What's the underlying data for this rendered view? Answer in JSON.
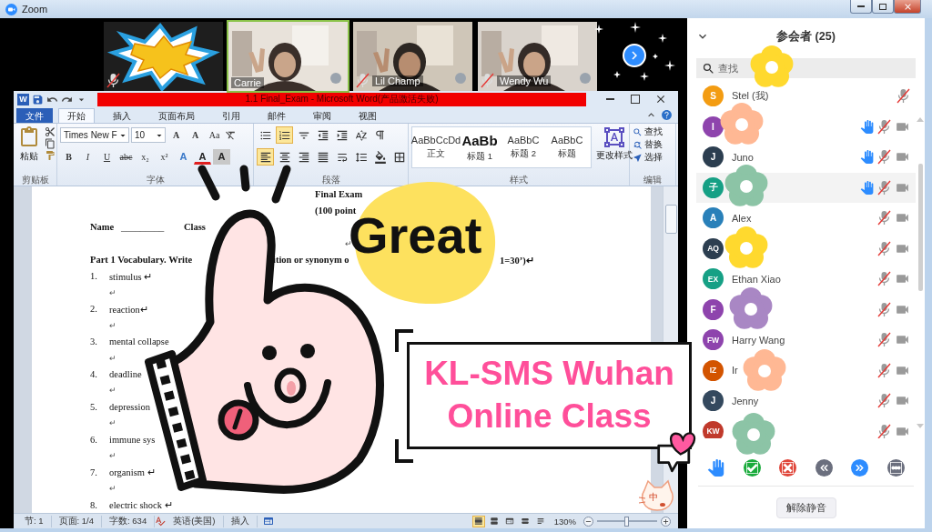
{
  "zoom_window": {
    "title": "Zoom"
  },
  "video_tiles": [
    {
      "kind": "sticker",
      "speaking": false,
      "muted": true
    },
    {
      "kind": "camera",
      "name": "Carrie",
      "speaking": true,
      "muted": false
    },
    {
      "kind": "camera",
      "name": "Lil Champ",
      "speaking": false,
      "muted": true
    },
    {
      "kind": "camera",
      "name": "Wendy Wu",
      "speaking": false,
      "muted": true
    }
  ],
  "word": {
    "logo": "W",
    "title": "1.1 Final_Exam - Microsoft Word(产品激活失败)",
    "tabs": [
      {
        "label": "文件",
        "kind": "file",
        "selected": false
      },
      {
        "label": "开始",
        "kind": "tab",
        "selected": true
      },
      {
        "label": "插入",
        "kind": "tab",
        "selected": false
      },
      {
        "label": "页面布局",
        "kind": "tab",
        "selected": false
      },
      {
        "label": "引用",
        "kind": "tab",
        "selected": false
      },
      {
        "label": "邮件",
        "kind": "tab",
        "selected": false
      },
      {
        "label": "审阅",
        "kind": "tab",
        "selected": false
      },
      {
        "label": "视图",
        "kind": "tab",
        "selected": false
      }
    ],
    "ribbon": {
      "groups": [
        "剪贴板",
        "字体",
        "段落",
        "样式",
        "编辑"
      ],
      "paste": "粘贴",
      "font_name": "Times New F",
      "font_size": "10",
      "size_buttons": [
        "A",
        "A"
      ],
      "case_button": "Aa",
      "format_buttons": [
        "B",
        "I",
        "U",
        "abc",
        "x₂",
        "x²"
      ],
      "color_buttons": [
        "A",
        "A",
        "A"
      ],
      "list_buttons": [
        {
          "selected": false
        },
        {
          "selected": true
        },
        {
          "selected": false
        }
      ],
      "align_buttons": [
        {
          "selected": true
        },
        {
          "selected": false
        },
        {
          "selected": false
        },
        {
          "selected": false
        },
        {
          "selected": false
        }
      ],
      "styles": [
        {
          "sample": "AaBbCcDd",
          "name": "正文"
        },
        {
          "sample": "AaBb",
          "name": "标题 1"
        },
        {
          "sample": "AaBbC",
          "name": "标题 2"
        },
        {
          "sample": "AaBbC",
          "name": "标题"
        }
      ],
      "change_styles": "更改样式",
      "editing": [
        "查找",
        "替换",
        "选择"
      ]
    },
    "document": {
      "title": "Final Exam",
      "subtitle": "(100 point",
      "name_label": "Name",
      "name_blank": "_________",
      "class_label": "Class",
      "return_mark": "↵",
      "instruction_parts": [
        "Part 1 Vocabulary. Write",
        "ition or synonym o",
        "1=30’)↵"
      ],
      "items": [
        {
          "number": "1.",
          "text": "stimulus ↵",
          "mark": "↵"
        },
        {
          "number": "2.",
          "text": "reaction↵",
          "mark": "↵"
        },
        {
          "number": "3.",
          "text": "mental collapse",
          "mark": "↵"
        },
        {
          "number": "4.",
          "text": "deadline",
          "mark": "↵"
        },
        {
          "number": "5.",
          "text": "depression",
          "mark": "↵"
        },
        {
          "number": "6.",
          "text": "immune sys",
          "mark": "↵"
        },
        {
          "number": "7.",
          "text": "organism ↵",
          "mark": "↵"
        },
        {
          "number": "8.",
          "text": "electric shock ↵"
        }
      ]
    },
    "status_bar": {
      "items": [
        "节: 1",
        "页面: 1/4",
        "字数: 634",
        "英语(美国)",
        "插入"
      ],
      "view_buttons": [
        {
          "selected": true
        },
        {
          "selected": false
        },
        {
          "selected": false
        },
        {
          "selected": false
        },
        {
          "selected": false
        }
      ],
      "zoom": "130%",
      "zoom_slider": {
        "level": 0.5
      }
    }
  },
  "participants": {
    "title": "参会者 (25)",
    "search": {
      "placeholder": "查找"
    },
    "rows": [
      {
        "initials": "S",
        "color": "#f39c12",
        "name": "Stel",
        "me": "(我)",
        "hand": false,
        "muted": true,
        "video": false,
        "highlighted": false
      },
      {
        "initials": "I",
        "color": "#8e44ad",
        "hand": true,
        "muted": true,
        "video": true,
        "highlighted": false
      },
      {
        "initials": "J",
        "color": "#2c3e50",
        "name": "Juno",
        "hand": true,
        "muted": true,
        "video": true,
        "highlighted": false
      },
      {
        "initials": "子",
        "color": "#16a085",
        "hand": true,
        "muted": true,
        "video": true,
        "highlighted": true
      },
      {
        "initials": "A",
        "color": "#2980b9",
        "name": "Alex",
        "hand": false,
        "muted": true,
        "video": true,
        "highlighted": false
      },
      {
        "initials": "AQ",
        "color": "#2c3e50",
        "hand": false,
        "muted": true,
        "video": true,
        "highlighted": false
      },
      {
        "initials": "EX",
        "color": "#16a085",
        "name": "Ethan Xiao",
        "hand": false,
        "muted": true,
        "video": true,
        "highlighted": false
      },
      {
        "initials": "F",
        "color": "#8e44ad",
        "hand": false,
        "muted": true,
        "video": true,
        "highlighted": false
      },
      {
        "initials": "FW",
        "color": "#8e44ad",
        "name": "Harry Wang",
        "hand": false,
        "muted": true,
        "video": true,
        "highlighted": false
      },
      {
        "initials": "IZ",
        "color": "#d35400",
        "name": "Ir",
        "hand": false,
        "muted": true,
        "video": true,
        "highlighted": false
      },
      {
        "initials": "J",
        "color": "#34495e",
        "name": "Jenny",
        "hand": false,
        "muted": true,
        "video": true,
        "highlighted": false
      },
      {
        "initials": "KW",
        "color": "#c0392b",
        "hand": false,
        "muted": true,
        "video": true,
        "highlighted": false
      }
    ],
    "unmute_all": "解除静音"
  },
  "stickers": {
    "great": "Great",
    "banner": [
      "KL-SMS Wuhan",
      "Online Class"
    ],
    "ime": "中",
    "flowers": [
      {
        "color": "#ffd92e"
      },
      {
        "color": "#ffb894"
      },
      {
        "color": "#8cc4a6"
      },
      {
        "color": "#ffd92e"
      },
      {
        "color": "#a987c4"
      },
      {
        "color": "#ffb894"
      },
      {
        "color": "#8cc4a6"
      }
    ]
  }
}
